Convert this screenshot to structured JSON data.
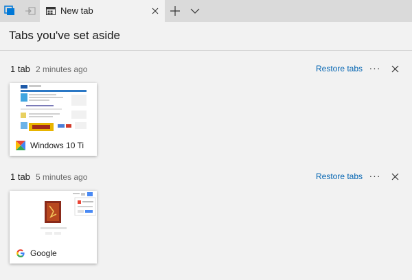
{
  "tabstrip": {
    "active_tab": {
      "title": "New tab",
      "icon": "new-tab-page-icon"
    },
    "set_aside_button_icon": "tabs-aside-icon",
    "set_aside_action_icon": "set-tabs-aside-icon",
    "new_tab_icon": "plus-icon",
    "tab_list_icon": "chevron-down-icon"
  },
  "panel": {
    "title": "Tabs you've set aside",
    "groups": [
      {
        "count": "1 tab",
        "time": "2 minutes ago",
        "restore_label": "Restore tabs",
        "more_label": "···",
        "tabs": [
          {
            "title": "Windows 10 Ti",
            "favicon": "windows10-tips-favicon"
          }
        ]
      },
      {
        "count": "1 tab",
        "time": "5 minutes ago",
        "restore_label": "Restore tabs",
        "more_label": "···",
        "tabs": [
          {
            "title": "Google",
            "favicon": "google-g-icon"
          }
        ]
      }
    ]
  },
  "colors": {
    "accent": "#0063b1",
    "strip": "#dadada",
    "panel": "#f2f2f2"
  }
}
